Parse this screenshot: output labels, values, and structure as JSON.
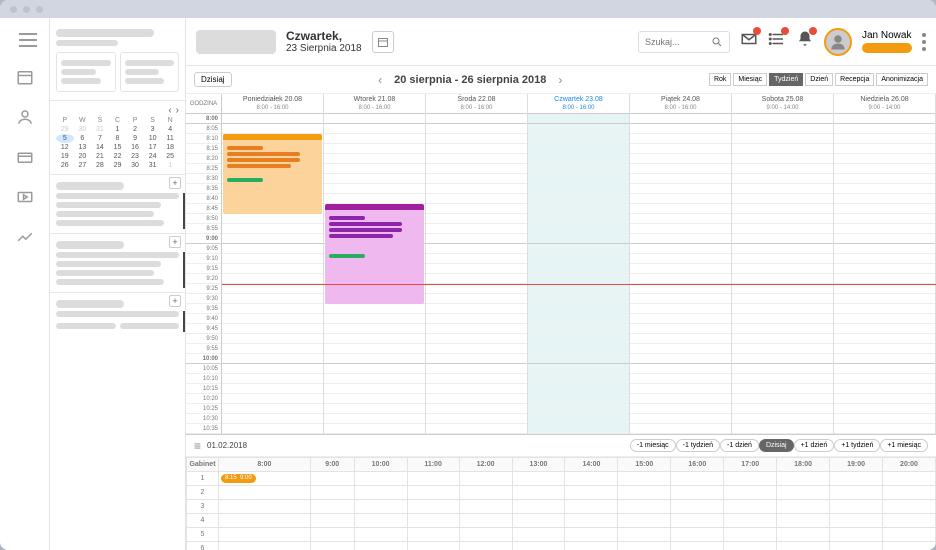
{
  "header": {
    "day_name": "Czwartek,",
    "date_full": "23 Sierpnia 2018",
    "search_placeholder": "Szukaj...",
    "user_name": "Jan Nowak"
  },
  "toolbar": {
    "today": "Dzisiaj",
    "prev": "‹",
    "next": "›",
    "range": "20 sierpnia - 26 sierpnia 2018",
    "views": [
      "Rok",
      "Miesiąc",
      "Tydzień",
      "Dzień",
      "Recepcja",
      "Anonimizacja"
    ],
    "active_view": "Tydzień"
  },
  "calendar": {
    "hour_label": "GODZINA",
    "days": [
      {
        "title": "Poniedziałek 20.08",
        "hours": "8:00 - 16:00",
        "today": false
      },
      {
        "title": "Wtorek 21.08",
        "hours": "8:00 - 16:00",
        "today": false
      },
      {
        "title": "Środa 22.08",
        "hours": "8:00 - 16:00",
        "today": false
      },
      {
        "title": "Czwartek 23.08",
        "hours": "8:00 - 16:00",
        "today": true
      },
      {
        "title": "Piątek 24.08",
        "hours": "8:00 - 16:00",
        "today": false
      },
      {
        "title": "Sobota 25.08",
        "hours": "9:00 - 14:00",
        "today": false
      },
      {
        "title": "Niedziela 26.08",
        "hours": "9:00 - 14:00",
        "today": false
      }
    ],
    "slots": [
      "8:00",
      "8:05",
      "8:10",
      "8:15",
      "8:20",
      "8:25",
      "8:30",
      "8:35",
      "8:40",
      "8:45",
      "8:50",
      "8:55",
      "9:00",
      "9:05",
      "9:10",
      "9:15",
      "9:20",
      "9:25",
      "9:30",
      "9:35",
      "9:40",
      "9:45",
      "9:50",
      "9:55",
      "10:00",
      "10:05",
      "10:10",
      "10:15",
      "10:20",
      "10:25",
      "10:30",
      "10:35"
    ]
  },
  "minicalendar": {
    "dow": [
      "P",
      "W",
      "Ś",
      "C",
      "P",
      "S",
      "N"
    ],
    "weeks": [
      [
        {
          "d": 29,
          "o": true
        },
        {
          "d": 30,
          "o": true
        },
        {
          "d": 31,
          "o": true
        },
        {
          "d": 1
        },
        {
          "d": 2
        },
        {
          "d": 3
        },
        {
          "d": 4
        }
      ],
      [
        {
          "d": 5,
          "t": true
        },
        {
          "d": 6
        },
        {
          "d": 7
        },
        {
          "d": 8
        },
        {
          "d": 9
        },
        {
          "d": 10
        },
        {
          "d": 11
        }
      ],
      [
        {
          "d": 12
        },
        {
          "d": 13
        },
        {
          "d": 14
        },
        {
          "d": 15
        },
        {
          "d": 16
        },
        {
          "d": 17
        },
        {
          "d": 18
        }
      ],
      [
        {
          "d": 19
        },
        {
          "d": 20
        },
        {
          "d": 21
        },
        {
          "d": 22
        },
        {
          "d": 23
        },
        {
          "d": 24
        },
        {
          "d": 25
        }
      ],
      [
        {
          "d": 26
        },
        {
          "d": 27
        },
        {
          "d": 28
        },
        {
          "d": 29
        },
        {
          "d": 30
        },
        {
          "d": 31
        },
        {
          "d": 1,
          "o": true
        }
      ]
    ]
  },
  "bottom": {
    "date": "01.02.2018",
    "nav": [
      "-1 miesiąc",
      "-1 tydzień",
      "-1 dzień",
      "Dzisiaj",
      "+1 dzień",
      "+1 tydzień",
      "+1 miesiąc"
    ],
    "active": "Dzisiaj",
    "row_label": "Gabinet",
    "hours": [
      "8:00",
      "9:00",
      "10:00",
      "11:00",
      "12:00",
      "13:00",
      "14:00",
      "15:00",
      "16:00",
      "17:00",
      "18:00",
      "19:00",
      "20:00"
    ],
    "rows": [
      1,
      2,
      3,
      4,
      5,
      6
    ],
    "appt": {
      "start": "8:15",
      "end": "9:00"
    }
  }
}
